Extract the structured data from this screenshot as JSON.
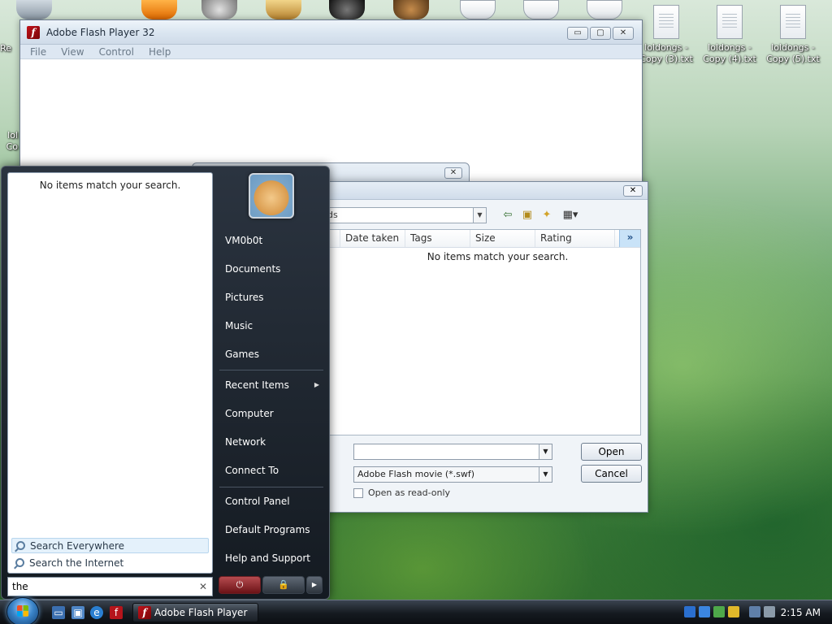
{
  "desktop": {
    "icons": [
      {
        "label": "loldongs - Copy (3).txt"
      },
      {
        "label": "loldongs - Copy (4).txt"
      },
      {
        "label": "loldongs - Copy (5).txt"
      }
    ],
    "edge_fragments": {
      "left_top": "Re",
      "left_mid_1": "lol",
      "left_mid_2": "Co"
    }
  },
  "flash_window": {
    "title": "Adobe Flash Player 32",
    "menu": [
      "File",
      "View",
      "Control",
      "Help"
    ],
    "buttons": {
      "minimize": "▭",
      "maximize": "▢",
      "close": "✕"
    }
  },
  "small_dialog": {
    "close": "✕"
  },
  "open_dialog": {
    "close": "✕",
    "path_fragment": "ds",
    "columns": [
      "Date taken",
      "Tags",
      "Size",
      "Rating"
    ],
    "more_columns": "»",
    "empty_message": "No items match your search.",
    "filename_value": "",
    "filetype_value": "Adobe Flash movie (*.swf)",
    "open_label": "Open",
    "cancel_label": "Cancel",
    "readonly_label": "Open as read-only"
  },
  "start_menu": {
    "no_match": "No items match your search.",
    "search_everywhere": "Search Everywhere",
    "search_internet": "Search the Internet",
    "search_value": "the",
    "clear_symbol": "✕",
    "user_name": "VM0b0t",
    "items": {
      "documents": "Documents",
      "pictures": "Pictures",
      "music": "Music",
      "games": "Games",
      "recent": "Recent Items",
      "computer": "Computer",
      "network": "Network",
      "connect": "Connect To",
      "control_panel": "Control Panel",
      "default_programs": "Default Programs",
      "help": "Help and Support"
    },
    "power_symbol": "⏻",
    "lock_symbol": "🔒",
    "arrow_symbol": "▶"
  },
  "taskbar": {
    "task_title": "Adobe Flash Player 32",
    "clock": "2:15 AM"
  }
}
